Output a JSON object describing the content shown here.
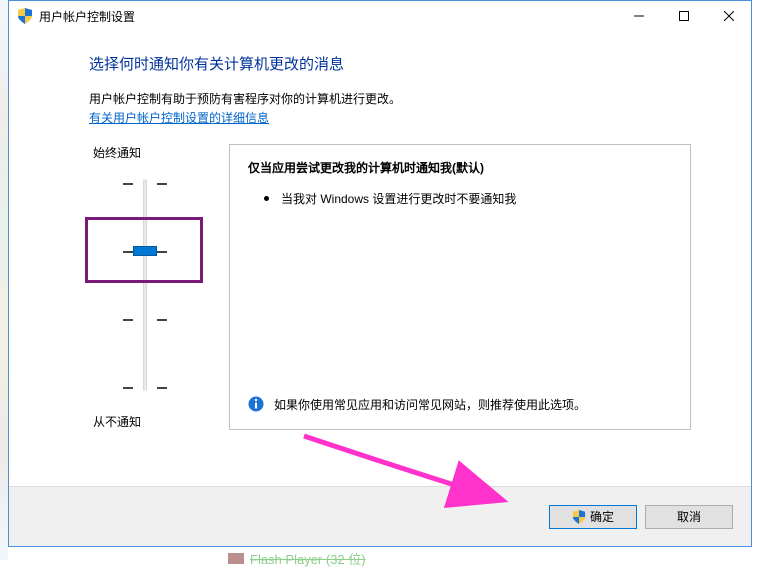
{
  "window": {
    "title": "用户帐户控制设置"
  },
  "heading": "选择何时通知你有关计算机更改的消息",
  "description": "用户帐户控制有助于预防有害程序对你的计算机进行更改。",
  "help_link": "有关用户帐户控制设置的详细信息",
  "slider": {
    "top_label": "始终通知",
    "bottom_label": "从不通知",
    "positions": 4,
    "current_index": 1
  },
  "option": {
    "title": "仅当应用尝试更改我的计算机时通知我(默认)",
    "bullets": [
      "当我对 Windows 设置进行更改时不要通知我"
    ],
    "info": "如果你使用常见应用和访问常见网站，则推荐使用此选项。"
  },
  "buttons": {
    "ok": "确定",
    "cancel": "取消"
  },
  "truncated_below": "Flash Player (32 位)"
}
